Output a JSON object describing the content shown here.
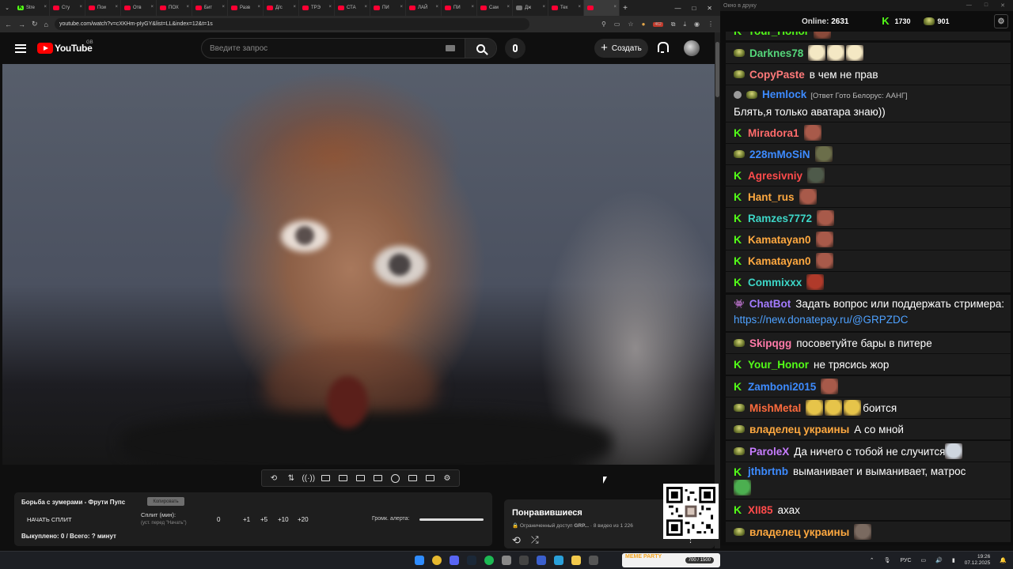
{
  "browser": {
    "tabs": [
      {
        "label": "Stre",
        "icon": "kick"
      },
      {
        "label": "Сту",
        "icon": "yt"
      },
      {
        "label": "Пои",
        "icon": "yt"
      },
      {
        "label": "Отв",
        "icon": "yt"
      },
      {
        "label": "ПОХ",
        "icon": "yt"
      },
      {
        "label": "Бит",
        "icon": "yt"
      },
      {
        "label": "Разв",
        "icon": "yt"
      },
      {
        "label": "Д/с",
        "icon": "yt"
      },
      {
        "label": "ТРЭ",
        "icon": "yt"
      },
      {
        "label": "СТА",
        "icon": "yt"
      },
      {
        "label": "ПИ",
        "icon": "yt"
      },
      {
        "label": "ЛАЙ",
        "icon": "yt"
      },
      {
        "label": "ПИ",
        "icon": "yt"
      },
      {
        "label": "Сам",
        "icon": "yt"
      },
      {
        "label": "Дж",
        "icon": "web"
      },
      {
        "label": "Тех",
        "icon": "yt"
      },
      {
        "label": "",
        "icon": "yt",
        "active": true
      }
    ],
    "url": "youtube.com/watch?v=cXKHm-pIyGY&list=LL&index=12&t=1s",
    "badge_count": "462"
  },
  "youtube": {
    "logo_text": "YouTube",
    "country": "GB",
    "search_placeholder": "Введите запрос",
    "create_label": "Создать"
  },
  "split": {
    "title": "Борьба с зумерами - Фрути Пупс",
    "copy_label": "Копировать",
    "start_label": "НАЧАТЬ СПЛИТ",
    "split_label": "Сплит (мин):",
    "split_hint": "(уст. перед \"Начать\")",
    "split_value": "0",
    "increments": [
      "+1",
      "+5",
      "+10",
      "+20"
    ],
    "volume_label": "Громк. алерта:",
    "bought": "Выкуплено: 0 / Всего: ? минут"
  },
  "liked": {
    "title": "Понравившиеся",
    "access": "Ограниченный доступ",
    "owner": "GRP...",
    "count": "· 8 видео из 1 226"
  },
  "chat": {
    "window_title": "Окно в друку",
    "online_label": "Online:",
    "online_count": "2631",
    "kick_count": "1730",
    "user_count": "901",
    "messages": [
      {
        "badge": "kick",
        "name": "Your_Honor",
        "color": "#53fc18",
        "text": "",
        "emotes": [
          "#8a4a3a"
        ]
      },
      {
        "badge": "sub",
        "name": "Darknes78",
        "color": "#55d67a",
        "text": "",
        "emotes": [
          "#f4e8c4",
          "#f4e8c4",
          "#f4e8c4"
        ]
      },
      {
        "badge": "sub",
        "name": "CopyPaste",
        "color": "#ff7a7a",
        "text": "в чем не прав",
        "emotes": []
      },
      {
        "badge": "mod",
        "badge2": "sub",
        "name": "Hemlock",
        "color": "#3d8bff",
        "reply": "[Ответ Гото Белорус: ААНГ]",
        "text": "Блять,я только аватара знаю))",
        "emotes": []
      },
      {
        "badge": "kick",
        "name": "Miradora1",
        "color": "#ff6b6b",
        "text": "",
        "emotes": [
          "#a85a4a"
        ]
      },
      {
        "badge": "sub",
        "name": "228mMoSiN",
        "color": "#3d8bff",
        "text": "",
        "emotes": [
          "#6b6e4a"
        ]
      },
      {
        "badge": "kick",
        "name": "Agresivniy",
        "color": "#ff4b4b",
        "text": "",
        "emotes": [
          "#4e5a4a"
        ]
      },
      {
        "badge": "kick",
        "name": "Hant_rus",
        "color": "#ffa940",
        "text": "",
        "emotes": [
          "#a85a4a"
        ]
      },
      {
        "badge": "kick",
        "name": "Ramzes7772",
        "color": "#3dd6c7",
        "text": "",
        "emotes": [
          "#a85a4a"
        ]
      },
      {
        "badge": "kick",
        "name": "Kamatayan0",
        "color": "#ffa940",
        "text": "",
        "emotes": [
          "#a85a4a"
        ]
      },
      {
        "badge": "kick",
        "name": "Kamatayan0",
        "color": "#ffa940",
        "text": "",
        "emotes": [
          "#a85a4a"
        ]
      },
      {
        "badge": "kick",
        "name": "Commixxx",
        "color": "#3dd6c7",
        "text": "",
        "emotes": [
          "#b03a2a"
        ]
      },
      {
        "badge": "bot",
        "name": "ChatBot",
        "color": "#a37bff",
        "text": "Задать вопрос или поддержать стримера:",
        "link": "https://new.donatepay.ru/@GRPZDC",
        "emotes": []
      },
      {
        "badge": "sub",
        "name": "Skipqgg",
        "color": "#ff7aa8",
        "text": "посоветуйте бары в питере",
        "emotes": []
      },
      {
        "badge": "kick",
        "name": "Your_Honor",
        "color": "#53fc18",
        "text": "не трясись жор",
        "emotes": []
      },
      {
        "badge": "kick",
        "name": "Zamboni2015",
        "color": "#3d8bff",
        "text": "",
        "emotes": [
          "#a85a4a"
        ]
      },
      {
        "badge": "sub",
        "name": "MishMetal",
        "color": "#ff6b3d",
        "text": "боится",
        "emotes": [
          "#e6c44a",
          "#e6c44a",
          "#e6c44a"
        ]
      },
      {
        "badge": "sub",
        "name": "владелец украины",
        "color": "#ffa940",
        "text": "А со мной",
        "emotes": []
      },
      {
        "badge": "sub",
        "name": "ParoleX",
        "color": "#c77dff",
        "text": "Да ничего с тобой не случится",
        "emotes": [
          "#cfd6df"
        ],
        "emote_after": true
      },
      {
        "badge": "kick",
        "name": "jthbrtnb",
        "color": "#3d8bff",
        "text": "выманивает и выманивает, матрос",
        "emotes": [
          "#4caf50"
        ],
        "emote_newline": true
      },
      {
        "badge": "kick",
        "name": "XII85",
        "color": "#ff4b4b",
        "text": "ахах",
        "emotes": []
      },
      {
        "badge": "sub",
        "name": "владелец украины",
        "color": "#ffa940",
        "text": "",
        "emotes": [
          "#7a6a60"
        ]
      }
    ]
  },
  "taskbar": {
    "meme_logo": "MEME PARTY",
    "meme_count": "700 / 1500",
    "lang": "РУС",
    "time": "19:26",
    "date": "07.12.2025"
  }
}
